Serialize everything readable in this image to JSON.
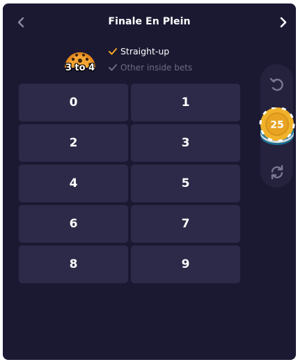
{
  "header": {
    "title": "Finale En Plein",
    "prev_icon": "chevron-left-icon",
    "next_icon": "chevron-right-icon"
  },
  "bet_info": {
    "payout": "3 to 4",
    "options": [
      {
        "label": "Straight-up",
        "checked": true,
        "color": "#f5a623"
      },
      {
        "label": "Other inside bets",
        "checked": true,
        "color": "#6e6c82"
      }
    ]
  },
  "numbers": [
    "0",
    "1",
    "2",
    "3",
    "4",
    "5",
    "6",
    "7",
    "8",
    "9"
  ],
  "controls": {
    "undo_icon": "undo-icon",
    "chip_value": "25",
    "chip_color": "#e6a320",
    "repeat_icon": "repeat-icon"
  },
  "colors": {
    "panel_bg": "#1b1932",
    "cell_bg": "#2c2a48",
    "accent": "#f5a623"
  }
}
